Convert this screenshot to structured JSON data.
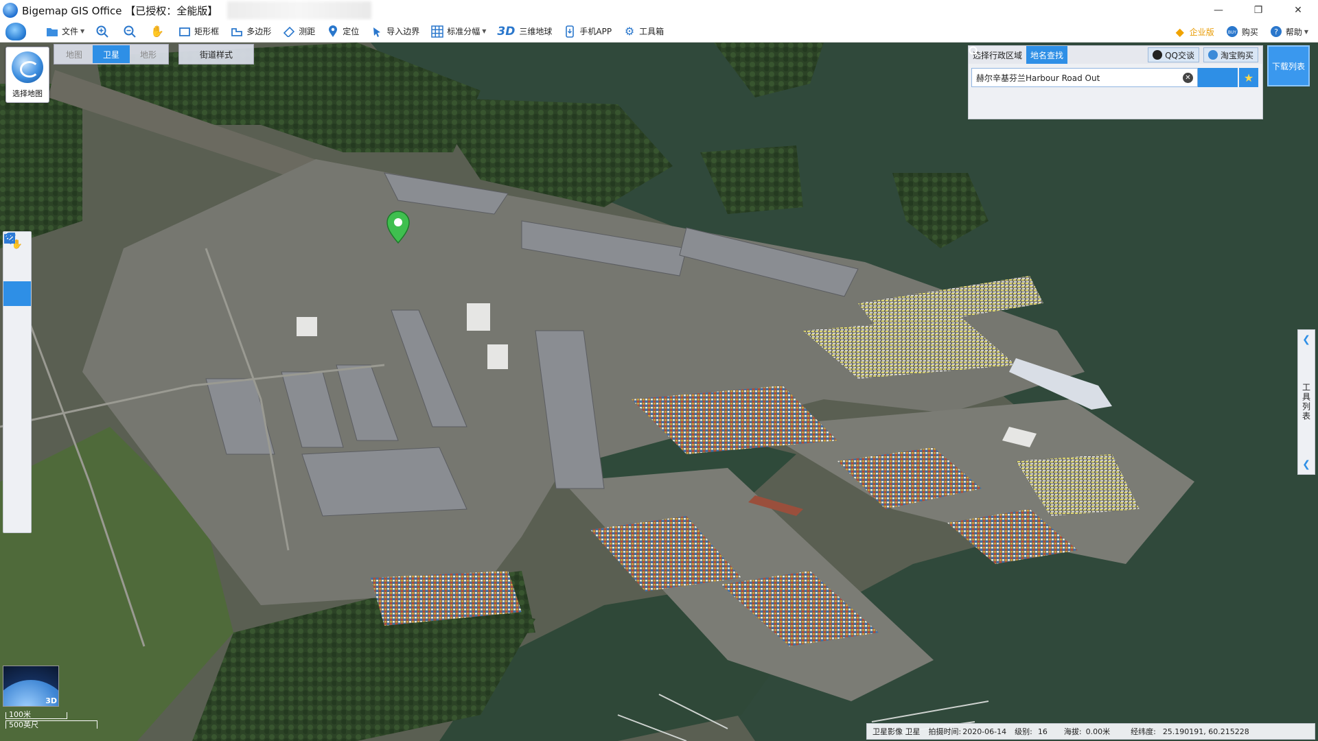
{
  "window": {
    "title": "Bigemap GIS Office 【已授权：全能版】",
    "controls": [
      "—",
      "❐",
      "✕"
    ]
  },
  "toolbar": {
    "items": [
      {
        "label": "文件",
        "icon": "folder-icon",
        "caret": true
      },
      {
        "label": "",
        "icon": "zoom-in-icon"
      },
      {
        "label": "",
        "icon": "zoom-out-icon"
      },
      {
        "label": "",
        "icon": "hand-icon"
      },
      {
        "label": "矩形框",
        "icon": "rectangle-select-icon"
      },
      {
        "label": "多边形",
        "icon": "polygon-select-icon"
      },
      {
        "label": "测距",
        "icon": "ruler-icon"
      },
      {
        "label": "定位",
        "icon": "location-pin-icon"
      },
      {
        "label": "导入边界",
        "icon": "import-boundary-icon"
      },
      {
        "label": "标准分幅",
        "icon": "grid-icon",
        "caret": true
      },
      {
        "label": "三维地球",
        "icon": "3d-icon",
        "glyph": "3D"
      },
      {
        "label": "手机APP",
        "icon": "phone-icon"
      },
      {
        "label": "工具箱",
        "icon": "gear-icon"
      }
    ],
    "right": [
      {
        "label": "企业版",
        "icon": "diamond-icon"
      },
      {
        "label": "购买",
        "icon": "buy-icon"
      },
      {
        "label": "帮助",
        "icon": "help-icon",
        "caret": true
      }
    ]
  },
  "map_controls": {
    "select_map_label": "选择地图",
    "layer_tabs": [
      "地图",
      "卫星",
      "地形"
    ],
    "active_layer": "卫星",
    "street_style_label": "街道样式"
  },
  "left_tools": [
    "hand-icon",
    "pointer-icon",
    "marker-icon",
    "line-icon",
    "polyline-icon",
    "circle-icon",
    "freehand-icon",
    "curve-icon",
    "rectangle-icon",
    "ruler-icon",
    "area-icon"
  ],
  "search_panel": {
    "tabs": [
      "选择行政区域",
      "地名查找"
    ],
    "active_tab": "地名查找",
    "qq_label": "QQ交谈",
    "taobao_label": "淘宝购买",
    "query": "赫尔辛基芬兰Harbour Road Out"
  },
  "download_list_label": "下载列表",
  "right_drawer_label": "工具列表",
  "minimap_label": "3D",
  "scale": {
    "metric": "100米",
    "imperial": "500英尺"
  },
  "status": {
    "source": "卫星影像 卫星",
    "capture_date_label": "拍摄时间:",
    "capture_date": "2020-06-14",
    "level_label": "级别:",
    "level": "16",
    "altitude_label": "海拔:",
    "altitude": "0.00米",
    "coords_label": "经纬度:",
    "coords": "25.190191, 60.215228"
  },
  "colors": {
    "accent": "#2e8fe6",
    "water": "#314a3c",
    "land": "#5f6656",
    "forest": "#2d4427"
  }
}
